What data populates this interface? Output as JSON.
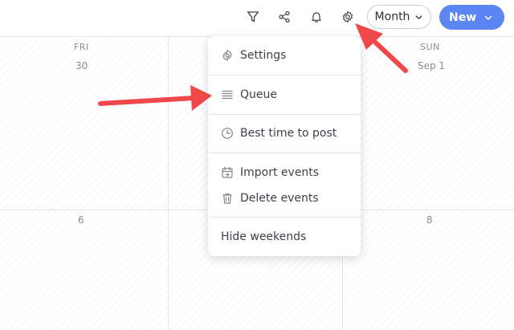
{
  "toolbar": {
    "filter_icon": "filter-icon",
    "share_icon": "share-icon",
    "bell_icon": "bell-icon",
    "gear_icon": "gear-icon",
    "view_select_label": "Month",
    "new_button_label": "New"
  },
  "calendar": {
    "columns": [
      {
        "day_name": "FRI",
        "week1_date": "30",
        "week2_date": "6"
      },
      {
        "day_name": "",
        "week1_date": "",
        "week2_date": ""
      },
      {
        "day_name": "SUN",
        "week1_date": "Sep 1",
        "week2_date": "8"
      }
    ]
  },
  "settings_menu": {
    "items": [
      {
        "label": "Settings",
        "icon": "gear-icon"
      },
      {
        "label": "Queue",
        "icon": "list-icon"
      },
      {
        "label": "Best time to post",
        "icon": "clock-icon"
      },
      {
        "label": "Import events",
        "icon": "calendar-import-icon"
      },
      {
        "label": "Delete events",
        "icon": "trash-icon"
      },
      {
        "label": "Hide weekends",
        "icon": ""
      }
    ]
  },
  "colors": {
    "primary": "#5a85f2",
    "annotation_arrow": "#f04848"
  }
}
